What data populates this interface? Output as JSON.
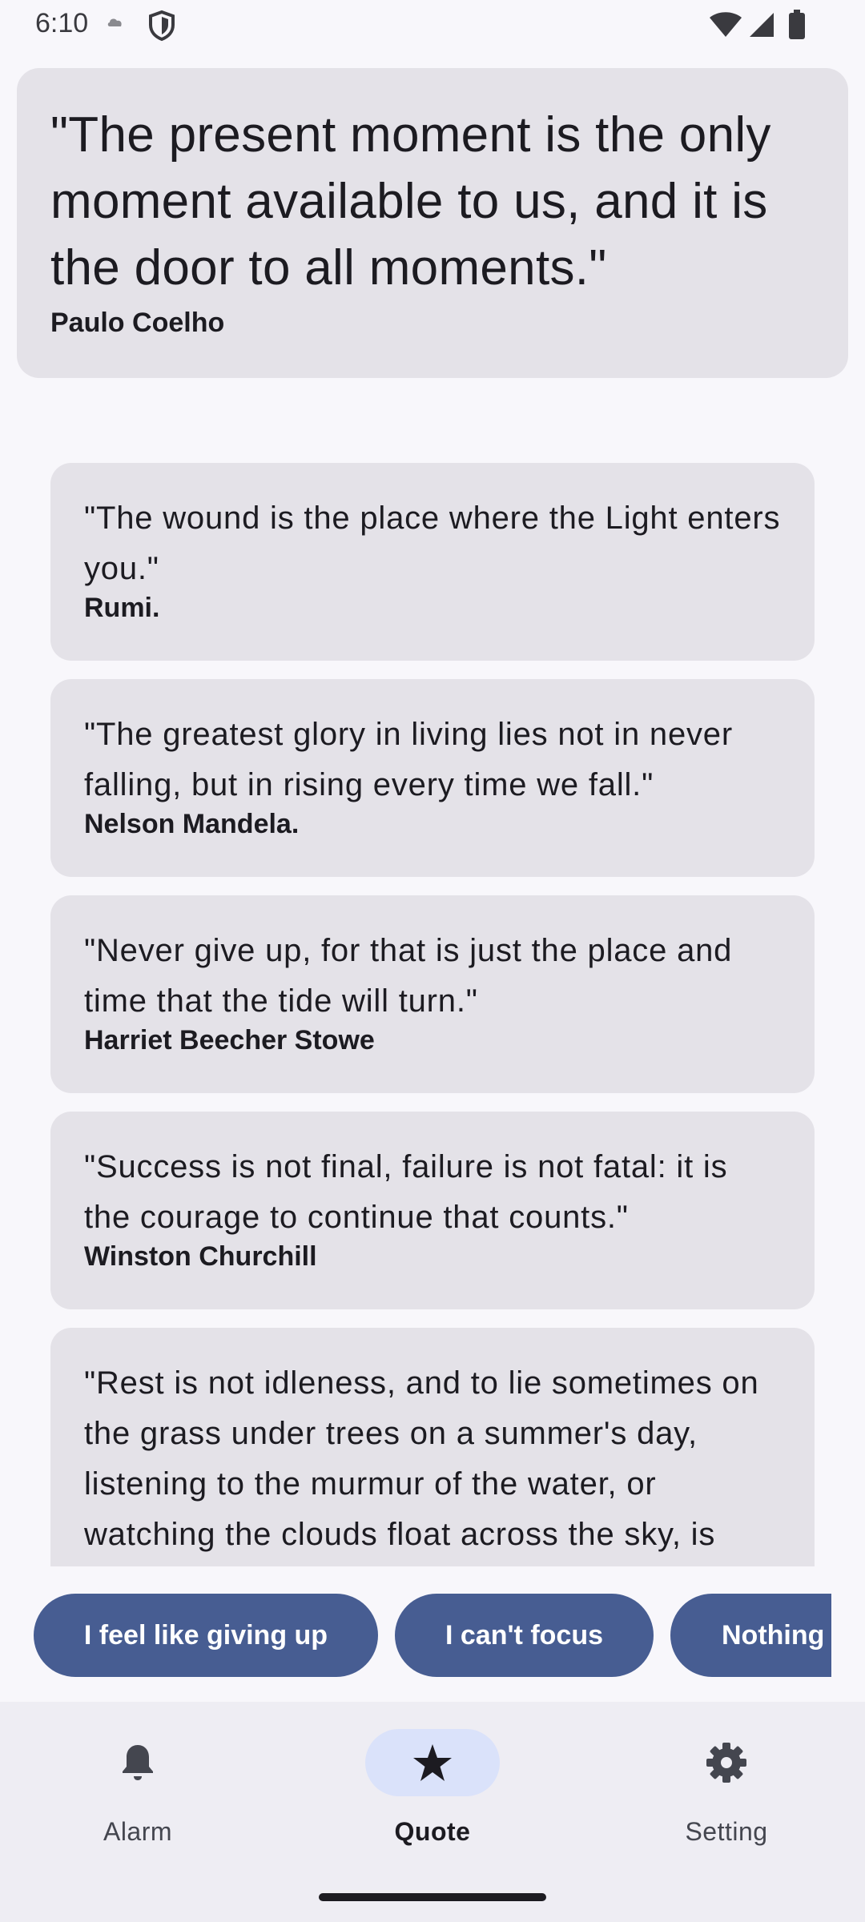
{
  "status_bar": {
    "time": "6:10"
  },
  "featured_quote": {
    "text": "\"The present moment is the only moment available to us, and it is the door to all moments.\"",
    "author": "Paulo Coelho"
  },
  "quotes": [
    {
      "text": "\"The wound is the place where the Light enters you.\"",
      "author": "Rumi."
    },
    {
      "text": "\"The greatest glory in living lies not in never falling, but in rising every time we fall.\"",
      "author": "Nelson Mandela."
    },
    {
      "text": "\"Never give up, for that is just the place and time that the tide will turn.\"",
      "author": "Harriet Beecher Stowe"
    },
    {
      "text": "\"Success is not final, failure is not fatal: it is the courage to continue that counts.\"",
      "author": "Winston Churchill"
    },
    {
      "text": "\"Rest is not idleness, and to lie sometimes on the grass under trees on a summer's day, listening to the murmur of the water, or watching the clouds float across the sky, is"
    }
  ],
  "chips": [
    "I feel like giving up",
    "I can't focus",
    "Nothing"
  ],
  "nav": {
    "items": [
      {
        "label": "Alarm",
        "icon": "bell-icon",
        "active": false
      },
      {
        "label": "Quote",
        "icon": "star-icon",
        "active": true
      },
      {
        "label": "Setting",
        "icon": "gear-icon",
        "active": false
      }
    ]
  },
  "colors": {
    "background": "#f8f7fb",
    "card": "#e4e2e8",
    "chip": "#475d92",
    "nav_background": "#eeedf3",
    "nav_active_indicator": "#dae2fa"
  }
}
